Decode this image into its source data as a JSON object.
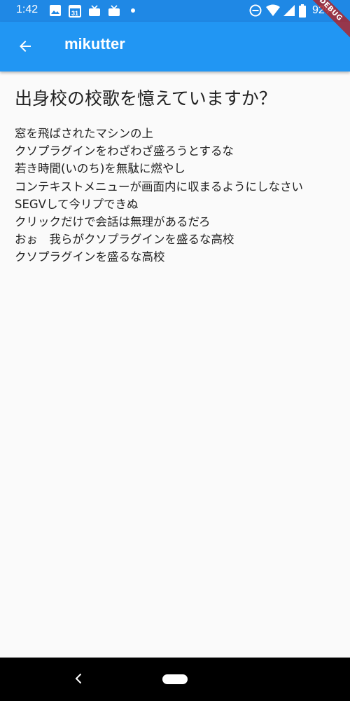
{
  "status_bar": {
    "time": "1:42",
    "battery": "92%",
    "icons_left": [
      "image-icon",
      "calendar-icon",
      "tv-icon",
      "tv-icon",
      "dot-icon"
    ],
    "calendar_day": "31",
    "icons_right": [
      "do-not-disturb-icon",
      "wifi-icon",
      "signal-icon",
      "battery-icon"
    ]
  },
  "debug_banner": "DEBUG",
  "app_bar": {
    "title": "mikutter",
    "color": "#2196f3"
  },
  "content": {
    "heading": "出身校の校歌を憶えていますか？",
    "lyrics": [
      "窓を飛ばされたマシンの上",
      "クソプラグインをわざわざ盛ろうとするな",
      "若き時間(いのち)を無駄に燃やし",
      "コンテキストメニューが画面内に収まるようにしなさい",
      "SEGVして今リプできぬ",
      "クリックだけで会話は無理があるだろ",
      "おぉ　我らがクソプラグインを盛るな高校",
      "クソプラグインを盛るな高校"
    ]
  },
  "nav_bar": {
    "back": "nav-back-icon",
    "home": "nav-home-pill"
  }
}
